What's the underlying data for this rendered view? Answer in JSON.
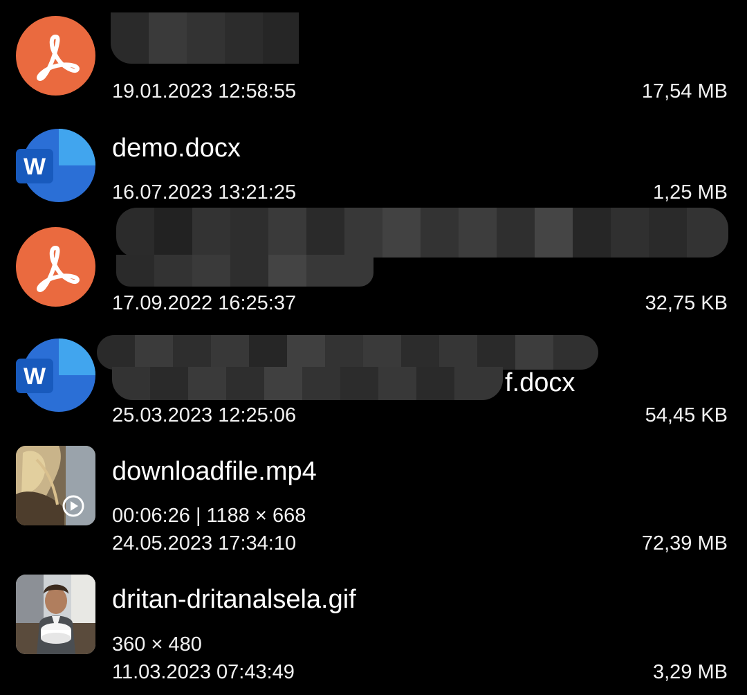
{
  "files": [
    {
      "type": "pdf",
      "name": "",
      "date": "19.01.2023 12:58:55",
      "size": "17,54 MB"
    },
    {
      "type": "word",
      "name": "demo.docx",
      "date": "16.07.2023 13:21:25",
      "size": "1,25 MB"
    },
    {
      "type": "pdf",
      "name": "",
      "date": "17.09.2022 16:25:37",
      "size": "32,75  KB"
    },
    {
      "type": "word",
      "name": "f.docx",
      "date": "25.03.2023 12:25:06",
      "size": "54,45  KB"
    },
    {
      "type": "video",
      "name": "downloadfile.mp4",
      "details": "00:06:26  |  1188 × 668",
      "date": "24.05.2023 17:34:10",
      "size": "72,39 MB"
    },
    {
      "type": "gif",
      "name": "dritan-dritanalsela.gif",
      "details": "360 × 480",
      "date": "11.03.2023 07:43:49",
      "size": "3,29 MB"
    }
  ],
  "icons": {
    "pdf": "acrobat-pdf-icon",
    "word": "word-icon",
    "video": "video-thumbnail",
    "gif": "gif-thumbnail",
    "play": "play-icon"
  },
  "colors": {
    "background": "#000000",
    "pdf_icon": "#ea6a3f",
    "word_icon": "#2b6fd6",
    "text": "#ffffff"
  }
}
